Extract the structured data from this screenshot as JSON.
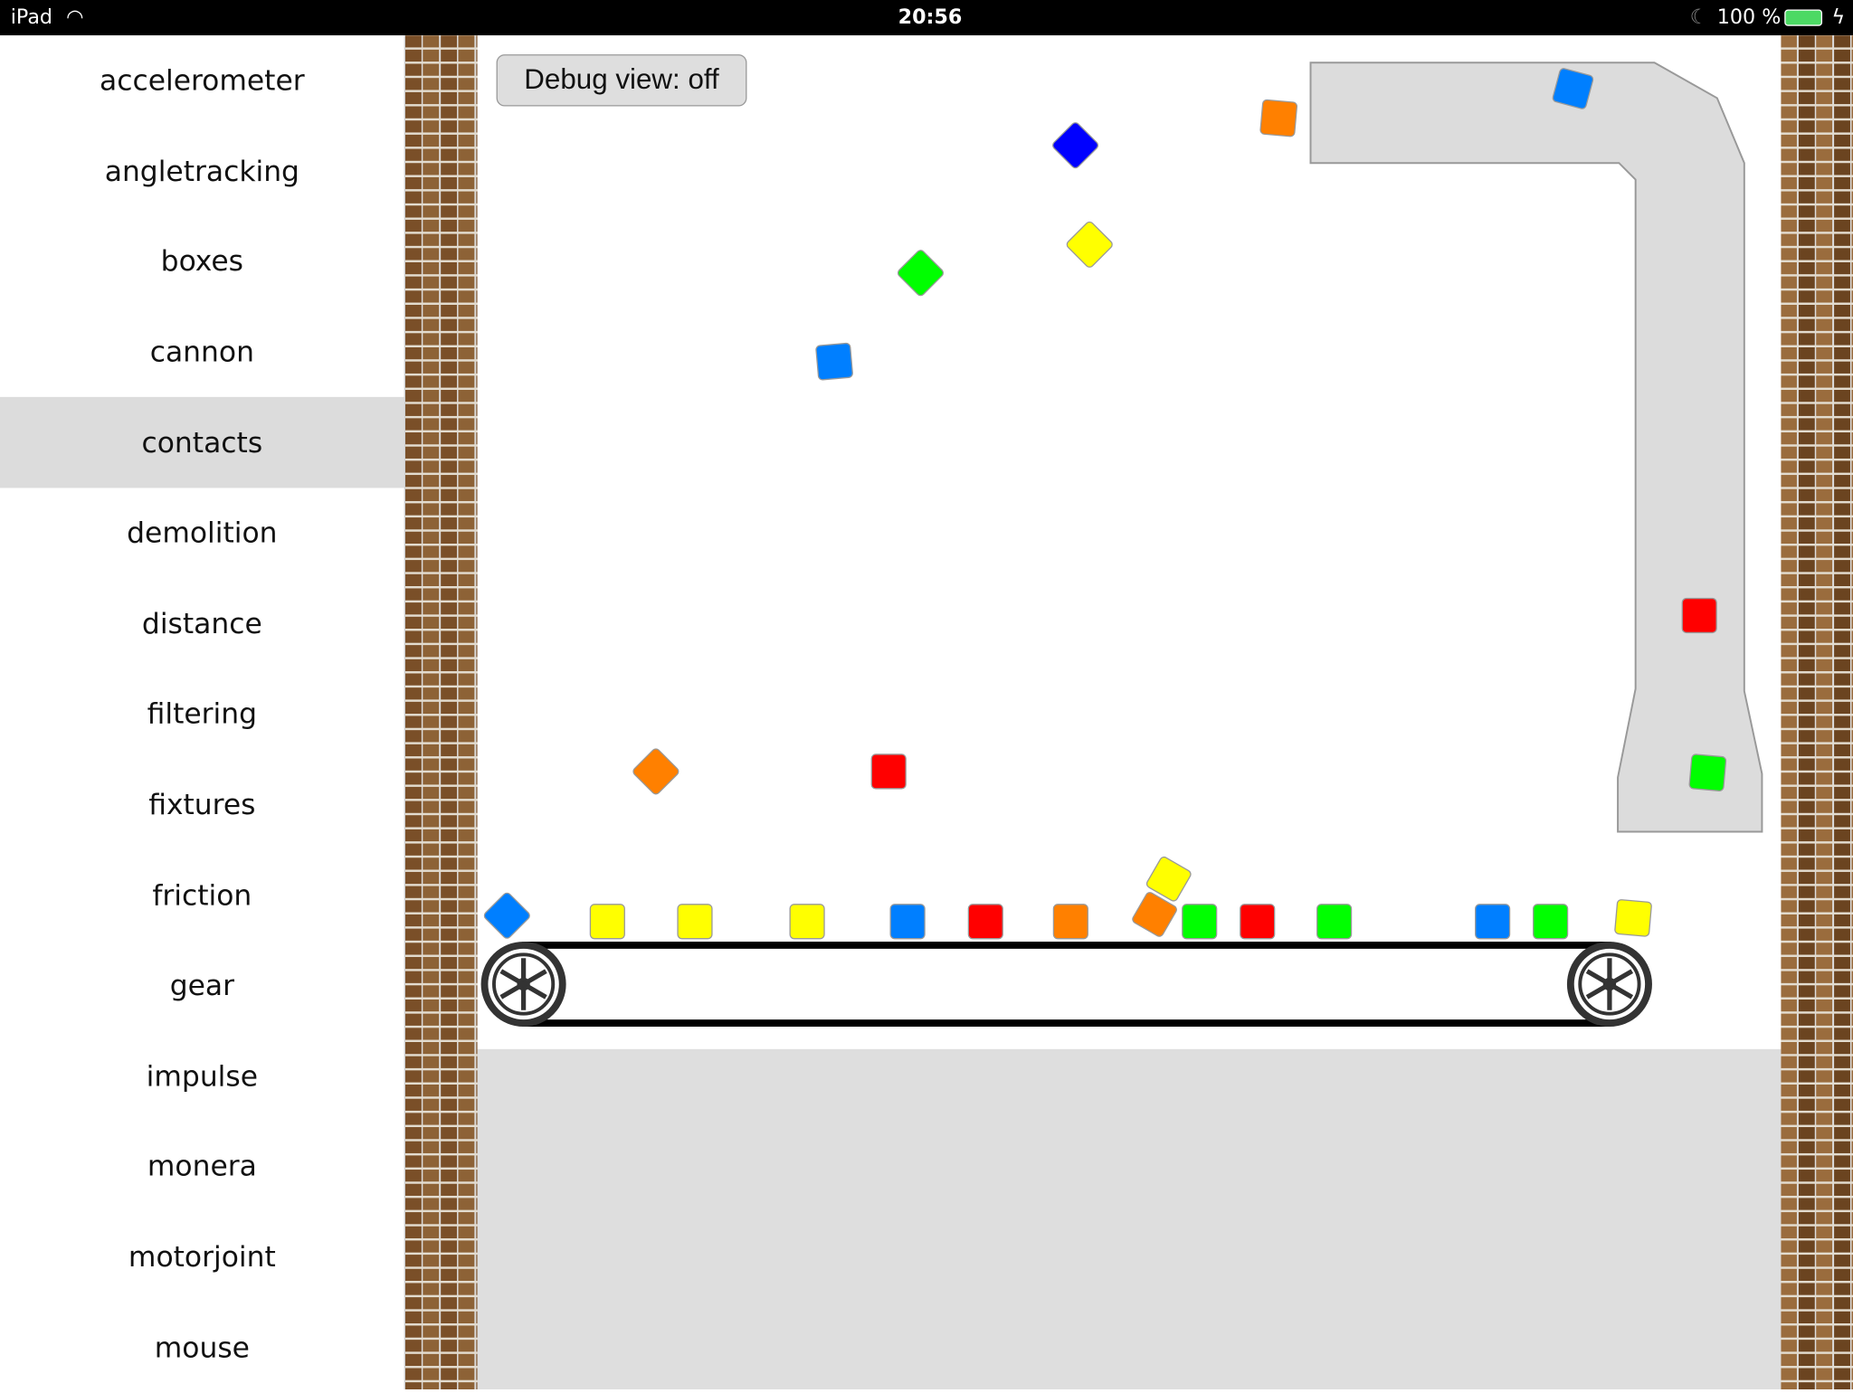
{
  "status_bar": {
    "device": "iPad",
    "time": "20:56",
    "battery": "100 %"
  },
  "sidebar": {
    "selected": "contacts",
    "items": [
      "accelerometer",
      "angletracking",
      "boxes",
      "cannon",
      "contacts",
      "demolition",
      "distance",
      "filtering",
      "fixtures",
      "friction",
      "gear",
      "impulse",
      "monera",
      "motorjoint",
      "mouse"
    ]
  },
  "scene": {
    "debug_button": "Debug view: off"
  },
  "colors": {
    "blue": "#007fff",
    "dark_blue": "#0000ff",
    "yellow": "#ffff00",
    "green": "#00ff00",
    "red": "#ff0000",
    "orange": "#ff8000"
  }
}
